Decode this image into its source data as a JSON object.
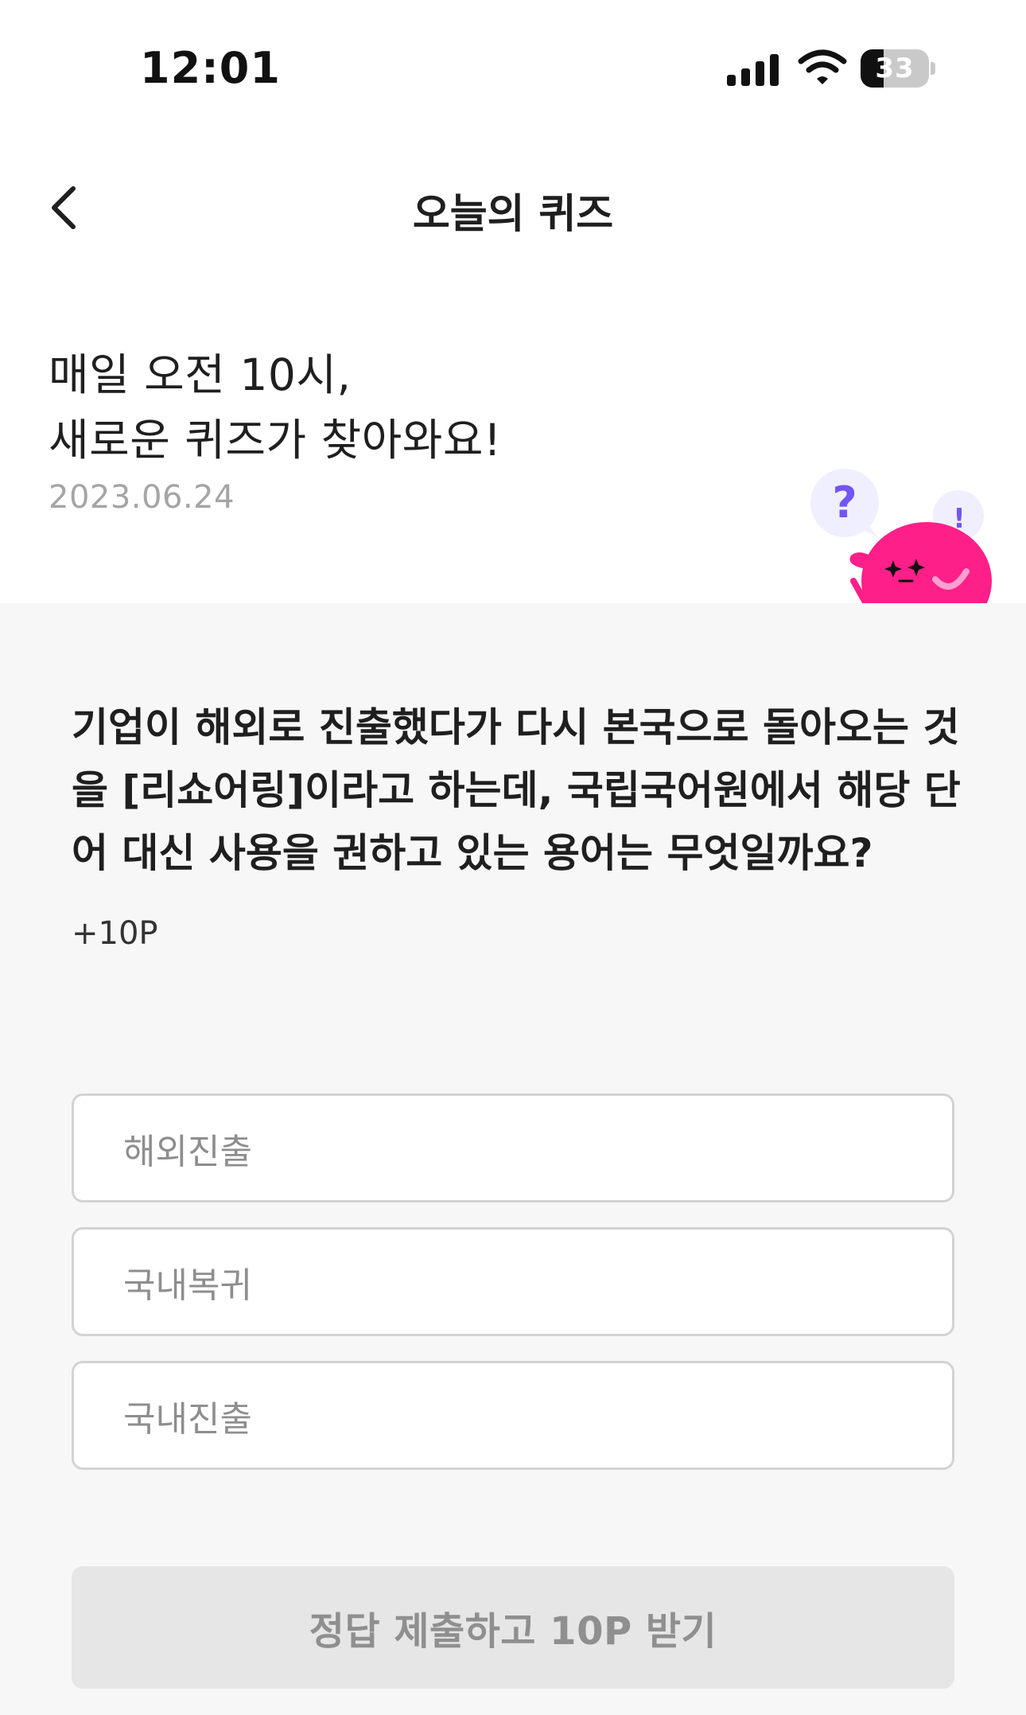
{
  "status_bar": {
    "time": "12:01",
    "battery_level": "33",
    "icons": [
      "signal-icon",
      "wifi-icon",
      "battery-icon"
    ]
  },
  "nav": {
    "title": "오늘의 퀴즈",
    "back_icon": "chevron-left-icon"
  },
  "intro": {
    "line1": "매일 오전 10시,",
    "line2": "새로운 퀴즈가 찾아와요!",
    "date": "2023.06.24"
  },
  "mascot": {
    "question_mark": "?",
    "exclamation_mark": "!",
    "colors": {
      "body": "#ff1f88",
      "bubble": "#f0efff",
      "mark": "#7255f4"
    }
  },
  "quiz": {
    "question": "기업이 해외로 진출했다가 다시 본국으로 돌아오는 것을 [리쇼어링]이라고 하는데, 국립국어원에서 해당 단어 대신 사용을 권하고 있는 용어는 무엇일까요?",
    "points": "+10P",
    "options": [
      "해외진출",
      "국내복귀",
      "국내진출"
    ]
  },
  "submit": {
    "label": "정답 제출하고 10P 받기"
  },
  "colors": {
    "page_background": "#f7f7f7",
    "header_background": "#ffffff",
    "disabled_button": "#e6e6e6"
  }
}
